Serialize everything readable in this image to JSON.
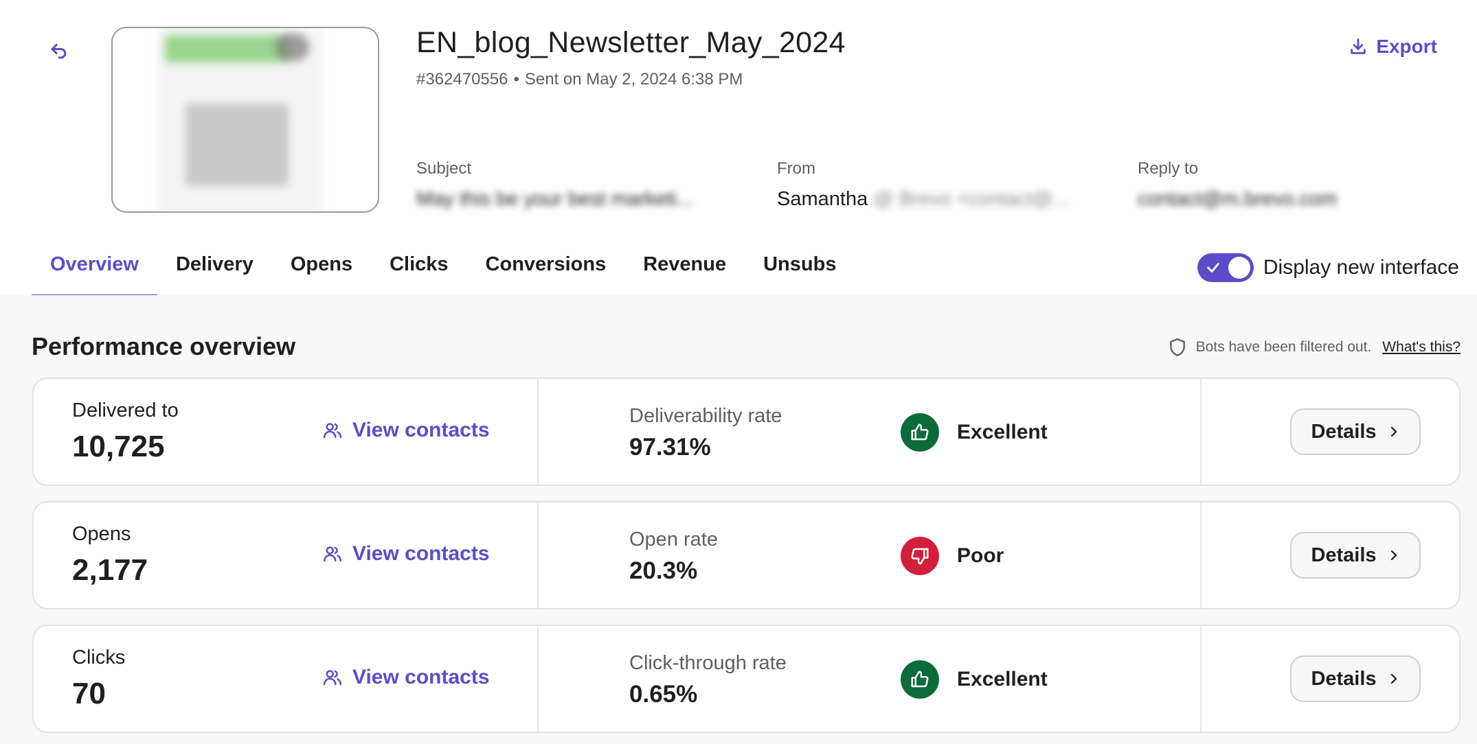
{
  "header": {
    "title": "EN_blog_Newsletter_May_2024",
    "campaign_id": "#362470556",
    "sent_on": "Sent on May 2, 2024 6:38 PM",
    "export_label": "Export"
  },
  "fields": {
    "subject": {
      "label": "Subject",
      "value": "May this be your best marketi..."
    },
    "from": {
      "label": "From",
      "name": "Samantha",
      "rest": "@ Brevo <contact@..."
    },
    "reply_to": {
      "label": "Reply to",
      "value": "contact@m.brevo.com"
    }
  },
  "tabs": [
    {
      "label": "Overview",
      "active": true
    },
    {
      "label": "Delivery"
    },
    {
      "label": "Opens"
    },
    {
      "label": "Clicks"
    },
    {
      "label": "Conversions"
    },
    {
      "label": "Revenue"
    },
    {
      "label": "Unsubs"
    }
  ],
  "toggle": {
    "label": "Display new interface",
    "on": true
  },
  "performance": {
    "title": "Performance overview",
    "bots_note": "Bots have been filtered out.",
    "bots_link": "What's this?",
    "cards": [
      {
        "count_label": "Delivered to",
        "count_value": "10,725",
        "view_label": "View contacts",
        "rate_label": "Deliverability rate",
        "rate_value": "97.31%",
        "status": "Excellent",
        "status_kind": "good",
        "details_label": "Details"
      },
      {
        "count_label": "Opens",
        "count_value": "2,177",
        "view_label": "View contacts",
        "rate_label": "Open rate",
        "rate_value": "20.3%",
        "status": "Poor",
        "status_kind": "bad",
        "details_label": "Details"
      },
      {
        "count_label": "Clicks",
        "count_value": "70",
        "view_label": "View contacts",
        "rate_label": "Click-through rate",
        "rate_value": "0.65%",
        "status": "Excellent",
        "status_kind": "good",
        "details_label": "Details"
      }
    ]
  },
  "colors": {
    "accent": "#5b4dc7",
    "good": "#0b6b3a",
    "bad": "#d21f3c"
  }
}
